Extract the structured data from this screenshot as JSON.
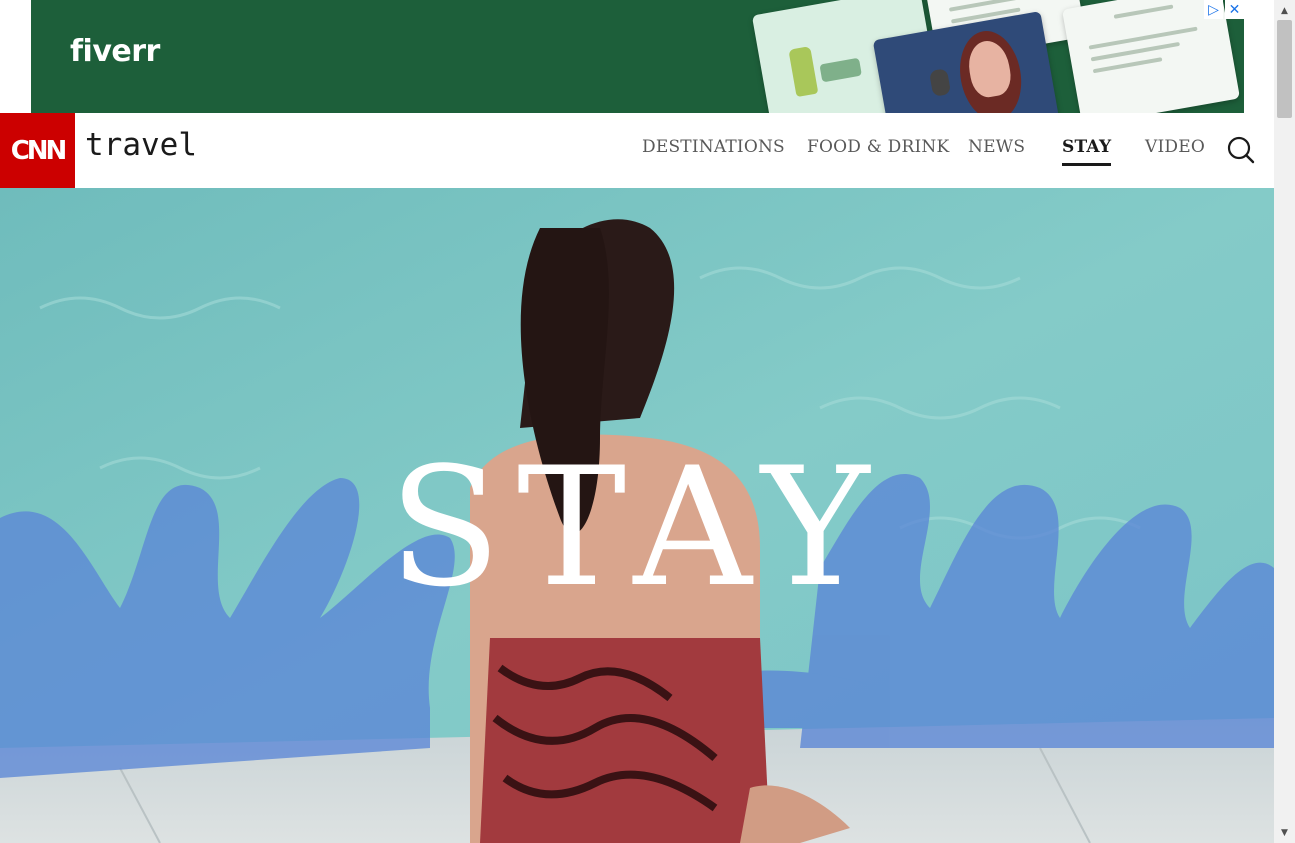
{
  "ad": {
    "logo": "fiverr",
    "adchoices_icon": "adchoices-icon",
    "close_icon": "close-icon",
    "close_label": "✕",
    "adchoices_label": "▷",
    "colors": {
      "background": "#1d5f3a"
    }
  },
  "header": {
    "logo_text": "CNN",
    "section": "travel",
    "nav": [
      {
        "label": "DESTINATIONS",
        "active": false
      },
      {
        "label": "FOOD & DRINK",
        "active": false
      },
      {
        "label": "NEWS",
        "active": false
      },
      {
        "label": "STAY",
        "active": true
      },
      {
        "label": "VIDEO",
        "active": false
      }
    ],
    "search_icon": "search-icon",
    "colors": {
      "brand": "#cc0000",
      "nav_text": "#595959",
      "nav_active": "#1a1a1a"
    }
  },
  "hero": {
    "title": "STAY",
    "colors": {
      "pool": "#79c4c5",
      "splash": "#5b86d6"
    }
  },
  "scrollbar": {
    "up_icon": "scroll-up-arrow-icon",
    "down_icon": "scroll-down-arrow-icon",
    "up_label": "▲",
    "down_label": "▼"
  }
}
